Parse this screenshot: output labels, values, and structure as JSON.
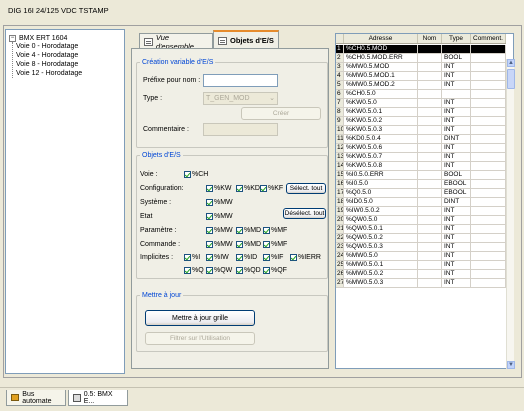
{
  "window": {
    "title": "DIG 16I 24/125 VDC TSTAMP"
  },
  "tree": {
    "root": "BMX ERT 1604",
    "items": [
      "Voie 0 - Horodatage",
      "Voie 4 - Horodatage",
      "Voie 8 - Horodatage",
      "Voie 12 - Horodatage"
    ]
  },
  "tabs": {
    "overview": "Vue d'ensemble",
    "io_objects": "Objets d'E/S"
  },
  "creation": {
    "legend": "Création variable d'E/S",
    "prefix_label": "Préfixe pour nom :",
    "prefix_value": "",
    "type_label": "Type :",
    "type_value": "T_GEN_MOD",
    "create_button": "Créer",
    "comment_label": "Commentaire :",
    "comment_value": ""
  },
  "io": {
    "legend": "Objets d'E/S",
    "voie_label": "Voie :",
    "config_label": "Configuration:",
    "system_label": "Système :",
    "state_label": "Etat",
    "param_label": "Paramètre :",
    "command_label": "Commande :",
    "implicit_label": "Implicites :",
    "select_all": "Sélect. tout",
    "deselect_all": "Désélect. tout",
    "cb": {
      "voie_ch": "%CH",
      "cfg_kw": "%KW",
      "cfg_kd": "%KD",
      "cfg_kf": "%KF",
      "sys_mw": "%MW",
      "etat_mw": "%MW",
      "par_mw": "%MW",
      "par_md": "%MD",
      "par_mf": "%MF",
      "cmd_mw": "%MW",
      "cmd_md": "%MD",
      "cmd_mf": "%MF",
      "imp_i": "%I",
      "imp_iw": "%IW",
      "imp_id": "%ID",
      "imp_if": "%IF",
      "imp_ierr": "%IERR",
      "imp_q": "%Q",
      "imp_qw": "%QW",
      "imp_qd": "%QD",
      "imp_qf": "%QF"
    }
  },
  "update": {
    "legend": "Mettre à jour",
    "update_button": "Mettre à jour grille",
    "filter_button": "Filtrer sur l'Utilisation"
  },
  "table": {
    "headers": [
      "",
      "Adresse",
      "Nom",
      "Type",
      "Comment."
    ],
    "rows": [
      [
        "1",
        "%CH0.5.MOD",
        "",
        "",
        ""
      ],
      [
        "2",
        "%CH0.5.MOD.ERR",
        "",
        "BOOL",
        ""
      ],
      [
        "3",
        "%MW0.5.MOD",
        "",
        "INT",
        ""
      ],
      [
        "4",
        "%MW0.5.MOD.1",
        "",
        "INT",
        ""
      ],
      [
        "5",
        "%MW0.5.MOD.2",
        "",
        "INT",
        ""
      ],
      [
        "6",
        "%CH0.5.0",
        "",
        "",
        ""
      ],
      [
        "7",
        "%KW0.5.0",
        "",
        "INT",
        ""
      ],
      [
        "8",
        "%KW0.5.0.1",
        "",
        "INT",
        ""
      ],
      [
        "9",
        "%KW0.5.0.2",
        "",
        "INT",
        ""
      ],
      [
        "10",
        "%KW0.5.0.3",
        "",
        "INT",
        ""
      ],
      [
        "11",
        "%KD0.5.0.4",
        "",
        "DINT",
        ""
      ],
      [
        "12",
        "%KW0.5.0.6",
        "",
        "INT",
        ""
      ],
      [
        "13",
        "%KW0.5.0.7",
        "",
        "INT",
        ""
      ],
      [
        "14",
        "%KW0.5.0.8",
        "",
        "INT",
        ""
      ],
      [
        "15",
        "%I0.5.0.ERR",
        "",
        "BOOL",
        ""
      ],
      [
        "16",
        "%I0.5.0",
        "",
        "EBOOL",
        ""
      ],
      [
        "17",
        "%Q0.5.0",
        "",
        "EBOOL",
        ""
      ],
      [
        "18",
        "%ID0.5.0",
        "",
        "DINT",
        ""
      ],
      [
        "19",
        "%IW0.5.0.2",
        "",
        "INT",
        ""
      ],
      [
        "20",
        "%QW0.5.0",
        "",
        "INT",
        ""
      ],
      [
        "21",
        "%QW0.5.0.1",
        "",
        "INT",
        ""
      ],
      [
        "22",
        "%QW0.5.0.2",
        "",
        "INT",
        ""
      ],
      [
        "23",
        "%QW0.5.0.3",
        "",
        "INT",
        ""
      ],
      [
        "24",
        "%MW0.5.0",
        "",
        "INT",
        ""
      ],
      [
        "25",
        "%MW0.5.0.1",
        "",
        "INT",
        ""
      ],
      [
        "26",
        "%MW0.5.0.2",
        "",
        "INT",
        ""
      ],
      [
        "27",
        "%MW0.5.0.3",
        "",
        "INT",
        ""
      ]
    ]
  },
  "bottom_tabs": [
    "Bus automate",
    "0.5: BMX E..."
  ]
}
